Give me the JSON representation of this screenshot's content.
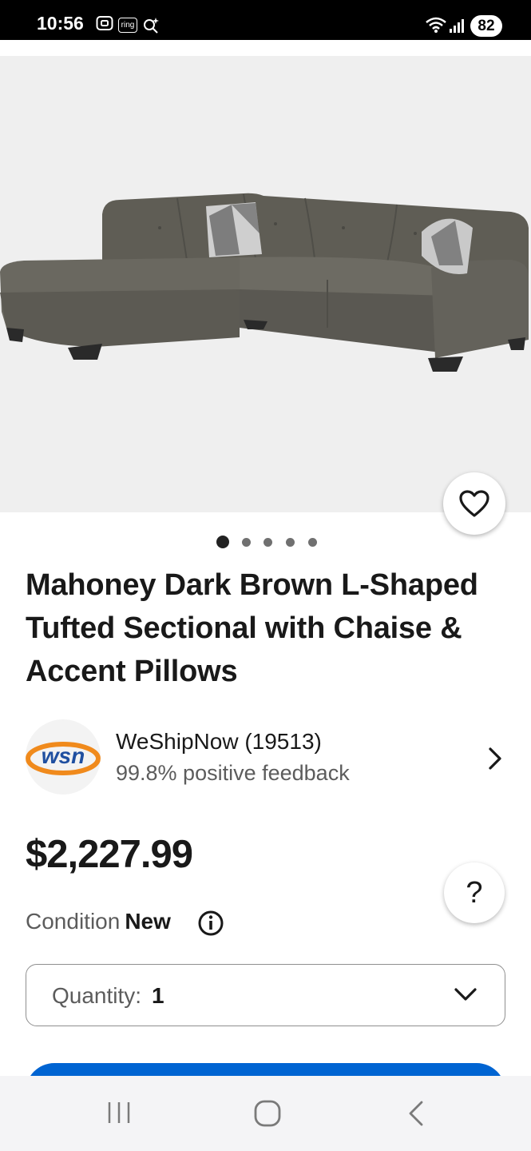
{
  "status_bar": {
    "time": "10:56",
    "ring_label": "ring",
    "battery": "82",
    "icons": [
      "screenshot-icon",
      "ring-icon",
      "search-sparkle-icon",
      "wifi-icon",
      "signal-icon"
    ]
  },
  "product": {
    "image_alt": "gray L-shaped sectional sofa",
    "carousel": {
      "count": 5,
      "active_index": 0
    },
    "title": "Mahoney Dark Brown L-Shaped Tufted Sectional with Chaise & Accent Pillows",
    "price": "$2,227.99",
    "condition_label": "Condition",
    "condition_value": "New"
  },
  "seller": {
    "logo_text": "wsn",
    "name": "WeShipNow (19513)",
    "feedback": "99.8% positive feedback"
  },
  "quantity": {
    "label": "Quantity:",
    "value": "1"
  },
  "help_button": "?",
  "colors": {
    "accent_blue": "#0064d2",
    "seller_logo_blue": "#1f4fa0",
    "seller_logo_orange": "#f08a1c"
  },
  "nav": {
    "items": [
      "recent-apps-icon",
      "home-icon",
      "back-icon"
    ]
  }
}
